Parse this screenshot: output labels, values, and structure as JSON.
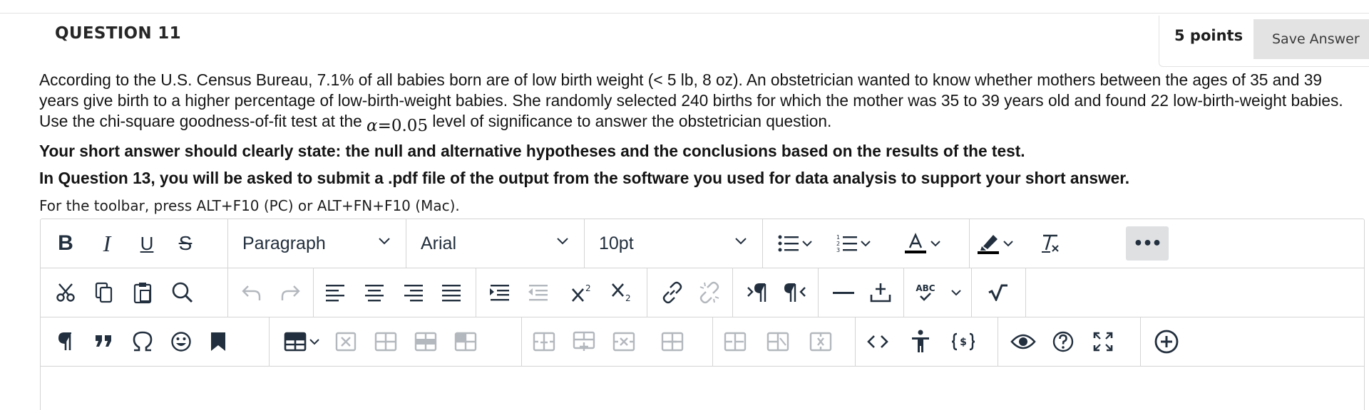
{
  "question": {
    "title": "QUESTION 11",
    "points": "5 points",
    "save_label": "Save Answer"
  },
  "body": {
    "p1_before": "According to the U.S. Census Bureau, 7.1% of all babies born are of low birth weight (< 5 lb, 8 oz). An obstetrician wanted to know whether mothers between the ages of 35 and 39 years give birth to a higher percentage of low-birth-weight babies. She randomly selected 240 births for which the mother was 35 to 39 years old and found 22 low-birth-weight babies. Use the chi-square goodness-of-fit test at the ",
    "alpha_symbol": "α",
    "alpha_value": "=0.05",
    "p1_after": " level of significance to answer the obstetrician question.",
    "p2": "Your short answer should clearly state: the null and alternative hypotheses and the conclusions based on the results of the test.",
    "p3": "In Question 13, you will be asked to submit a .pdf file of the output from the software you used for data analysis to support your short answer.",
    "toolbar_hint": "For the toolbar, press ALT+F10 (PC) or ALT+FN+F10 (Mac)."
  },
  "toolbar": {
    "block_format": "Paragraph",
    "font_family": "Arial",
    "font_size": "10pt",
    "bold_glyph": "B",
    "italic_glyph": "I",
    "underline_glyph": "U",
    "strike_glyph": "S",
    "spell_label": "ABC",
    "more_glyph": "•••"
  },
  "colors": {
    "text": "#222f3e",
    "disabled": "#b3b8be",
    "border": "#d4d4d4",
    "save_bg": "#e3e3e3"
  }
}
